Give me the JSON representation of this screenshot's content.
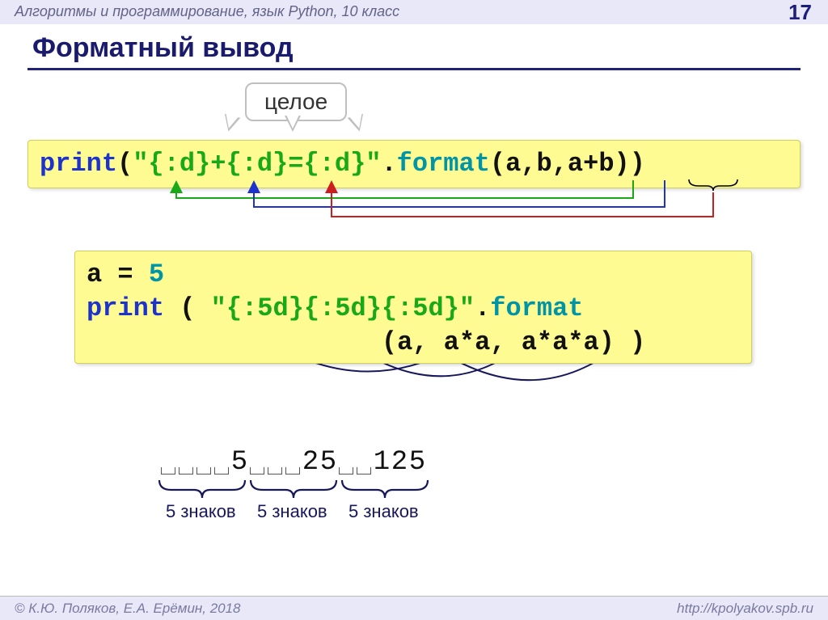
{
  "header": {
    "subject": "Алгоритмы и программирование, язык Python, 10 класс",
    "page": "17"
  },
  "title": "Форматный вывод",
  "callout": "целое",
  "code1": {
    "print": "print",
    "open": "(",
    "str": "\"{:d}+{:d}={:d}\"",
    "dot": ".",
    "format": "format",
    "args": "(a,b,",
    "apb": "a+b",
    "close": "))"
  },
  "code2": {
    "assign": "a = ",
    "five": "5",
    "print": "print",
    "sp": " ( ",
    "str": "\"{:5d}{:5d}{:5d}\"",
    "dot": ".",
    "format": "format",
    "args_l2": "                   (a, a*a, a*a*a) )"
  },
  "output_chars": [
    " ",
    " ",
    " ",
    " ",
    "5",
    " ",
    " ",
    " ",
    "2",
    "5",
    " ",
    " ",
    "1",
    "2",
    "5"
  ],
  "labels": {
    "l1": "5 знаков",
    "l2": "5 знаков",
    "l3": "5 знаков"
  },
  "footer": {
    "left": "© К.Ю. Поляков, Е.А. Ерёмин, 2018",
    "right": "http://kpolyakov.spb.ru"
  }
}
